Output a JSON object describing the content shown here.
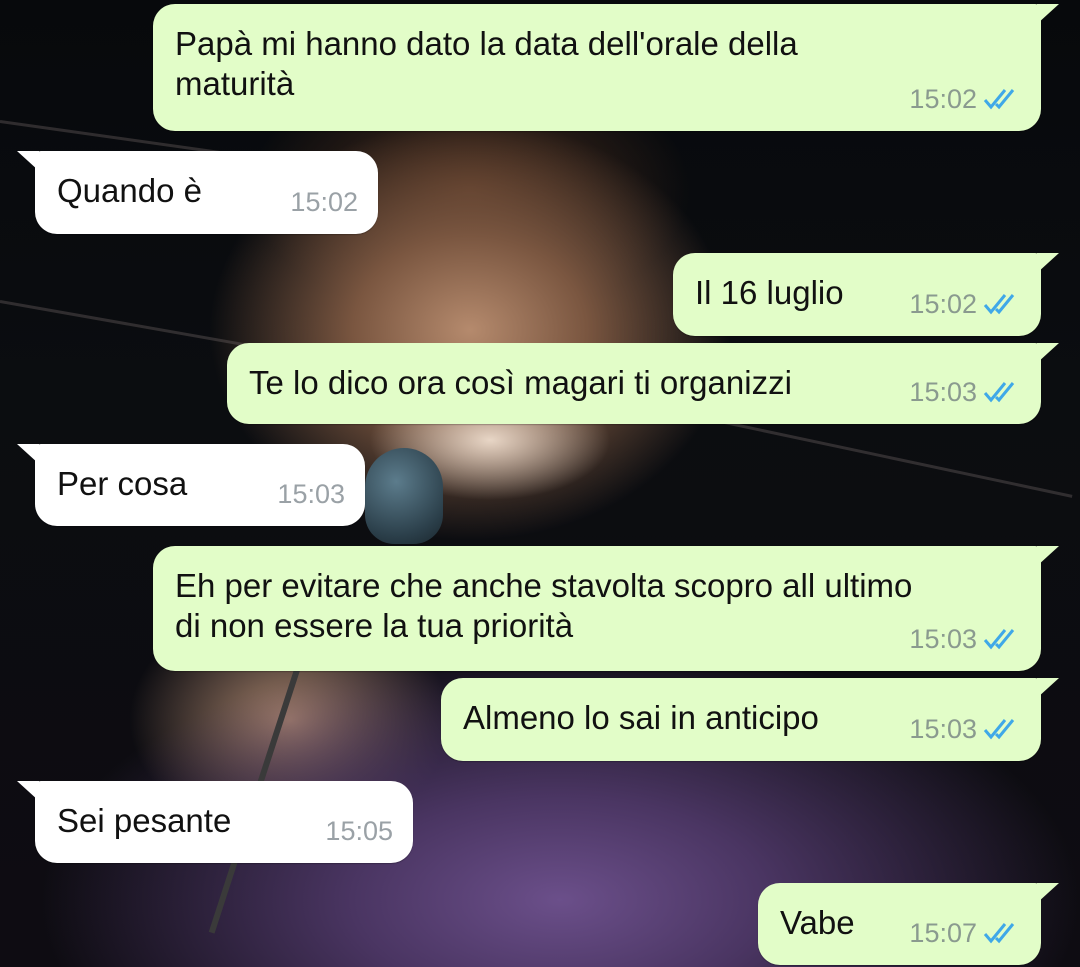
{
  "colors": {
    "outgoing_bubble": "#e2fdc8",
    "incoming_bubble": "#ffffff",
    "read_tick": "#3fa8e8",
    "timestamp": "#8a9a8f"
  },
  "messages": [
    {
      "direction": "out",
      "text": "Papà mi hanno dato la data dell'orale della\nmaturità",
      "time": "15:02",
      "status": "read-double-tick-icon"
    },
    {
      "direction": "in",
      "text": "Quando è",
      "time": "15:02"
    },
    {
      "direction": "out",
      "text": "Il 16 luglio",
      "time": "15:02",
      "status": "read-double-tick-icon"
    },
    {
      "direction": "out",
      "text": "Te lo dico ora così magari ti organizzi",
      "time": "15:03",
      "status": "read-double-tick-icon"
    },
    {
      "direction": "in",
      "text": "Per cosa",
      "time": "15:03"
    },
    {
      "direction": "out",
      "text": "Eh per evitare che anche stavolta scopro all ultimo\ndi non essere la tua priorità",
      "time": "15:03",
      "status": "read-double-tick-icon"
    },
    {
      "direction": "out",
      "text": "Almeno lo sai in anticipo",
      "time": "15:03",
      "status": "read-double-tick-icon"
    },
    {
      "direction": "in",
      "text": "Sei pesante",
      "time": "15:05"
    },
    {
      "direction": "out",
      "text": "Vabe",
      "time": "15:07",
      "status": "read-double-tick-icon"
    }
  ]
}
